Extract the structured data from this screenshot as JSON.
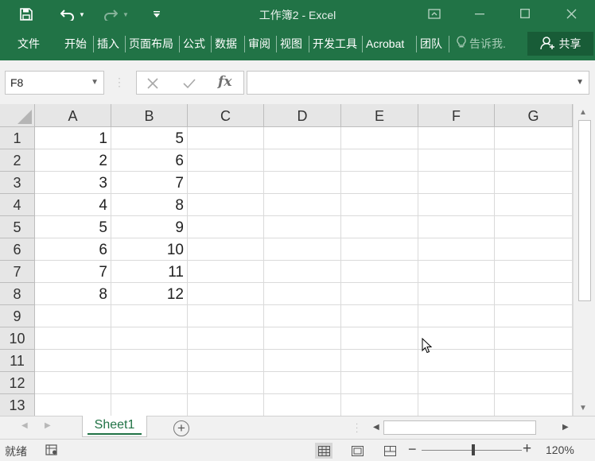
{
  "title": "工作簿2 - Excel",
  "ribbon_tabs": [
    "文件",
    "开始",
    "插入",
    "页面布局",
    "公式",
    "数据",
    "审阅",
    "视图",
    "开发工具",
    "Acrobat",
    "团队"
  ],
  "tell_me": "告诉我.",
  "share": "共享",
  "name_box": "F8",
  "formula_value": "",
  "columns": [
    "A",
    "B",
    "C",
    "D",
    "E",
    "F",
    "G"
  ],
  "rows": [
    "1",
    "2",
    "3",
    "4",
    "5",
    "6",
    "7",
    "8",
    "9",
    "10",
    "11",
    "12",
    "13"
  ],
  "cells": {
    "A": [
      "1",
      "2",
      "3",
      "4",
      "5",
      "6",
      "7",
      "8"
    ],
    "B": [
      "5",
      "6",
      "7",
      "8",
      "9",
      "10",
      "11",
      "12"
    ]
  },
  "sheet_tabs": [
    "Sheet1"
  ],
  "status": "就绪",
  "zoom": "120%",
  "colors": {
    "accent": "#217346",
    "share_bg": "#185c37"
  },
  "icons": [
    "save-icon",
    "undo-icon",
    "redo-icon",
    "customize-qat-icon",
    "ribbon-display-icon",
    "minimize-icon",
    "maximize-icon",
    "close-icon",
    "lightbulb-icon",
    "person-add-icon",
    "cancel-icon",
    "enter-icon",
    "fx-icon",
    "mouse-pointer-icon",
    "add-sheet-icon",
    "macro-record-icon",
    "normal-view-icon",
    "page-layout-view-icon",
    "page-break-view-icon"
  ]
}
